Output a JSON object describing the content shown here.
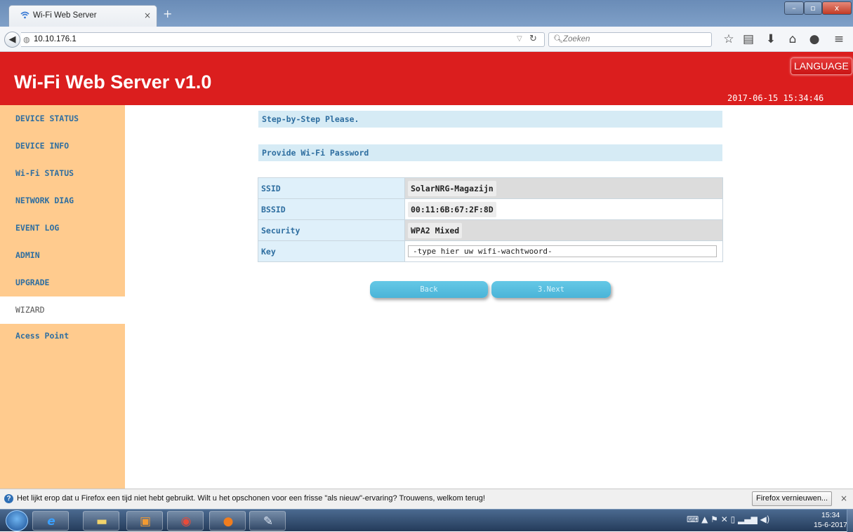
{
  "browser": {
    "tab_title": "Wi-Fi Web Server",
    "tab_close": "×",
    "new_tab": "+",
    "url": "10.10.176.1",
    "search_placeholder": "Zoeken",
    "window_buttons": {
      "minimize": "–",
      "maximize": "▫",
      "close": "x"
    },
    "toolbar_icons": [
      "star-icon",
      "reading-list-icon",
      "download-icon",
      "home-icon",
      "chat-icon",
      "menu-icon"
    ]
  },
  "header": {
    "title": "Wi-Fi Web Server v1.0",
    "language_button": "LANGUAGE",
    "datetime": "2017-06-15 15:34:46",
    "background_color": "#db1e1e"
  },
  "sidebar": {
    "items": [
      {
        "label": "DEVICE STATUS"
      },
      {
        "label": "DEVICE INFO"
      },
      {
        "label": "Wi-Fi STATUS"
      },
      {
        "label": "NETWORK DIAG"
      },
      {
        "label": "EVENT LOG"
      },
      {
        "label": "ADMIN"
      },
      {
        "label": "UPGRADE"
      },
      {
        "label": "WIZARD",
        "active": true
      },
      {
        "label": "Acess Point"
      }
    ],
    "background_color": "#ffcb8e"
  },
  "main": {
    "step_heading": "Step-by-Step Please.",
    "section_heading": "Provide Wi-Fi Password",
    "rows": [
      {
        "label": "SSID",
        "value": "SolarNRG-Magazijn"
      },
      {
        "label": "BSSID",
        "value": "00:11:6B:67:2F:8D"
      },
      {
        "label": "Security",
        "value": "WPA2 Mixed"
      },
      {
        "label": "Key",
        "value": "-type hier uw wifi-wachtwoord-"
      }
    ],
    "back_button": "Back",
    "next_button": "3.Next"
  },
  "notification": {
    "text": "Het lijkt erop dat u Firefox een tijd niet hebt gebruikt. Wilt u het opschonen voor een frisse \"als nieuw\"-ervaring? Trouwens, welkom terug!",
    "button": "Firefox vernieuwen...",
    "close": "×"
  },
  "taskbar": {
    "apps": [
      "internet-explorer-icon",
      "file-explorer-icon",
      "media-player-icon",
      "chrome-icon",
      "firefox-icon",
      "paint-icon"
    ],
    "clock_time": "15:34",
    "clock_date": "15-6-2017"
  }
}
